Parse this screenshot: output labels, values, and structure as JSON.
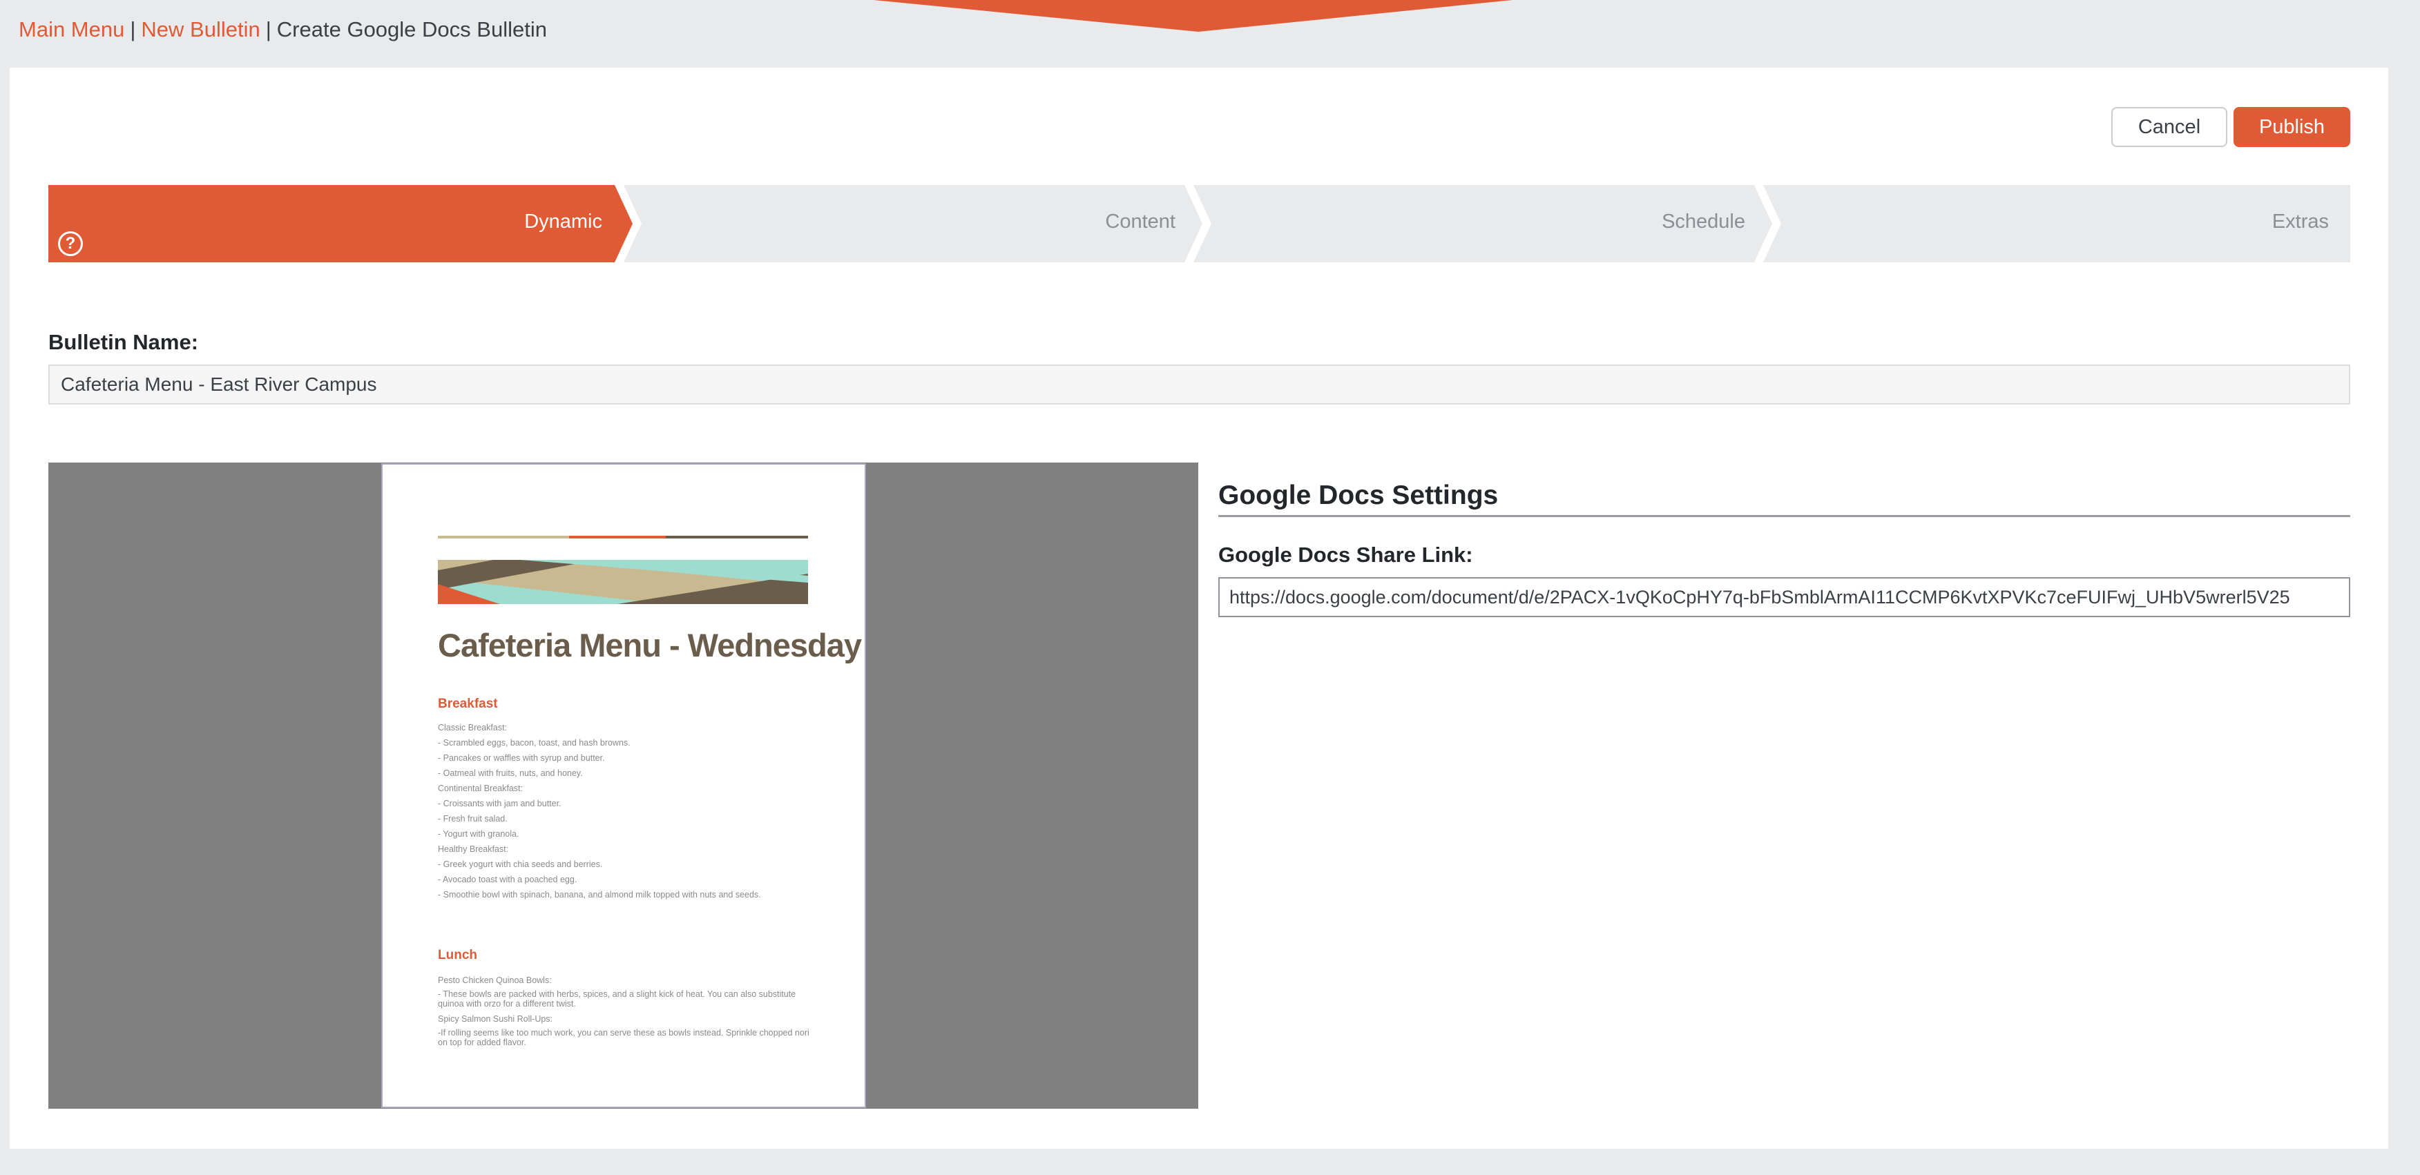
{
  "breadcrumb": {
    "main_menu": "Main Menu",
    "new_bulletin": "New Bulletin",
    "current": "Create Google Docs Bulletin",
    "separator": "|"
  },
  "actions": {
    "cancel_label": "Cancel",
    "publish_label": "Publish"
  },
  "steps": [
    {
      "label": "Dynamic",
      "active": true
    },
    {
      "label": "Content",
      "active": false
    },
    {
      "label": "Schedule",
      "active": false
    },
    {
      "label": "Extras",
      "active": false
    }
  ],
  "help_icon": "question-circle-icon",
  "bulletin": {
    "name_label": "Bulletin Name:",
    "name_value": "Cafeteria Menu - East River Campus"
  },
  "preview_doc": {
    "title": "Cafeteria Menu - Wednesday",
    "sections": [
      {
        "heading": "Breakfast",
        "lines": [
          "Classic Breakfast:",
          "- Scrambled eggs, bacon, toast, and hash browns.",
          "- Pancakes or waffles with syrup and butter.",
          "- Oatmeal with fruits, nuts, and honey.",
          "Continental Breakfast:",
          "- Croissants with jam and butter.",
          "- Fresh fruit salad.",
          "- Yogurt with granola.",
          "Healthy Breakfast:",
          "- Greek yogurt with chia seeds and berries.",
          "- Avocado toast with a poached egg.",
          "- Smoothie bowl with spinach, banana, and almond milk topped with nuts and seeds."
        ]
      },
      {
        "heading": "Lunch",
        "lines": [
          "Pesto Chicken Quinoa Bowls:",
          "- These bowls are packed with herbs, spices, and a slight kick of heat. You can also substitute quinoa with orzo for a different twist.",
          "Spicy Salmon Sushi Roll-Ups:",
          "-If rolling seems like too much work, you can serve these as bowls instead. Sprinkle chopped nori on top for added flavor."
        ]
      }
    ]
  },
  "settings": {
    "title": "Google Docs Settings",
    "link_label": "Google Docs Share Link:",
    "link_value": "https://docs.google.com/document/d/e/2PACX-1vQKoCpHY7q-bFbSmblArmAI11CCMP6KvtXPVKc7ceFUIFwj_UHbV5wrerl5V25"
  },
  "colors": {
    "accent": "#e05a35",
    "step_inactive": "#e9eaec",
    "preview_bg": "#808080",
    "doc_teal": "#9fdcd0",
    "doc_brown": "#6b5d4b",
    "doc_tan": "#c9b990"
  }
}
